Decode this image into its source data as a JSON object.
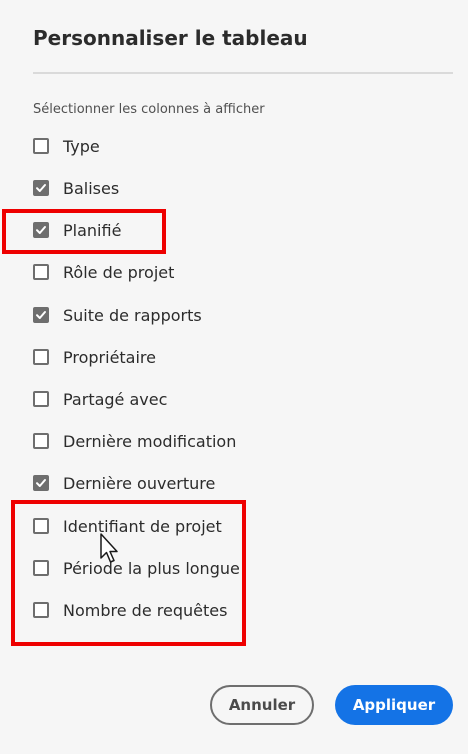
{
  "dialog": {
    "title": "Personnaliser le tableau",
    "subtitle": "Sélectionner les colonnes à afficher"
  },
  "columns": [
    {
      "label": "Type",
      "checked": false
    },
    {
      "label": "Balises",
      "checked": true
    },
    {
      "label": "Planifié",
      "checked": true
    },
    {
      "label": "Rôle de projet",
      "checked": false
    },
    {
      "label": "Suite de rapports",
      "checked": true
    },
    {
      "label": "Propriétaire",
      "checked": false
    },
    {
      "label": "Partagé avec",
      "checked": false
    },
    {
      "label": "Dernière modification",
      "checked": false
    },
    {
      "label": "Dernière ouverture",
      "checked": true
    },
    {
      "label": "Identifiant de projet",
      "checked": false
    },
    {
      "label": "Période la plus longue",
      "checked": false
    },
    {
      "label": "Nombre de requêtes",
      "checked": false
    }
  ],
  "buttons": {
    "cancel_label": "Annuler",
    "apply_label": "Appliquer"
  },
  "colors": {
    "accent": "#1473e6",
    "highlight": "#ee0000",
    "checkbox": "#6e6e6e"
  },
  "icons": {
    "checkbox_checked": "checkmark-icon",
    "cursor": "mouse-pointer-icon"
  }
}
